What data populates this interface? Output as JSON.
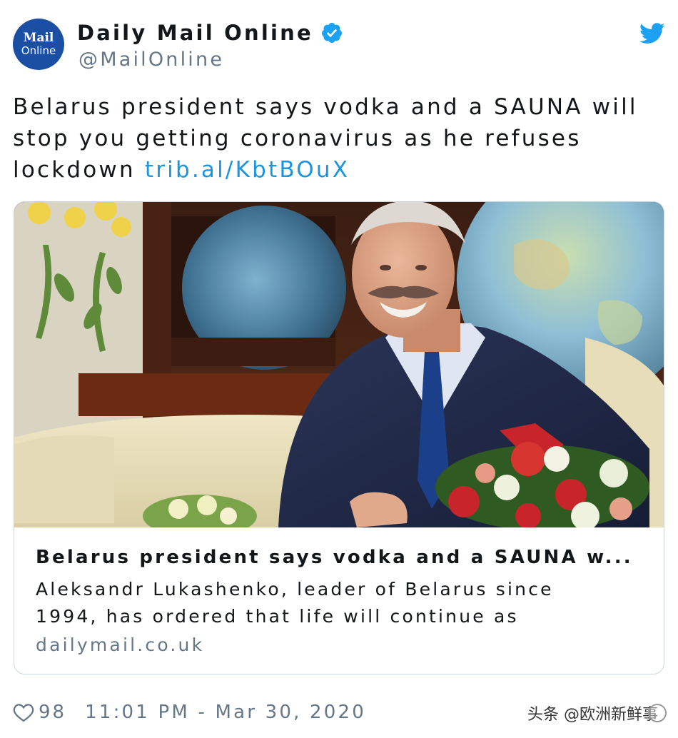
{
  "account": {
    "avatar_line1": "Mail",
    "avatar_line2": "Online",
    "display_name": "Daily Mail Online",
    "handle": "@MailOnline",
    "verified_icon": "verified-badge-icon",
    "platform_icon": "twitter-bird-icon"
  },
  "tweet": {
    "line1": "Belarus president says vodka and a SAUNA will",
    "line2": "stop you getting coronavirus as he refuses",
    "line3_text": "lockdown ",
    "link": "trib.al/KbtBOuX"
  },
  "card": {
    "title": "Belarus president says vodka and a SAUNA w...",
    "description_line1": "Aleksandr Lukashenko, leader of Belarus since",
    "description_line2": "1994, has ordered that life will continue as",
    "domain": "dailymail.co.uk"
  },
  "footer": {
    "likes": "98",
    "timestamp": "11:01 PM - Mar 30, 2020",
    "heart_icon": "heart-icon"
  },
  "watermark": {
    "text": "头条 @欧洲新鲜事"
  },
  "colors": {
    "link": "#1b95e0",
    "verified": "#1da1f2",
    "secondary_text": "#657786",
    "avatar_bg": "#1a4fa3",
    "border": "#ccd6dd"
  }
}
